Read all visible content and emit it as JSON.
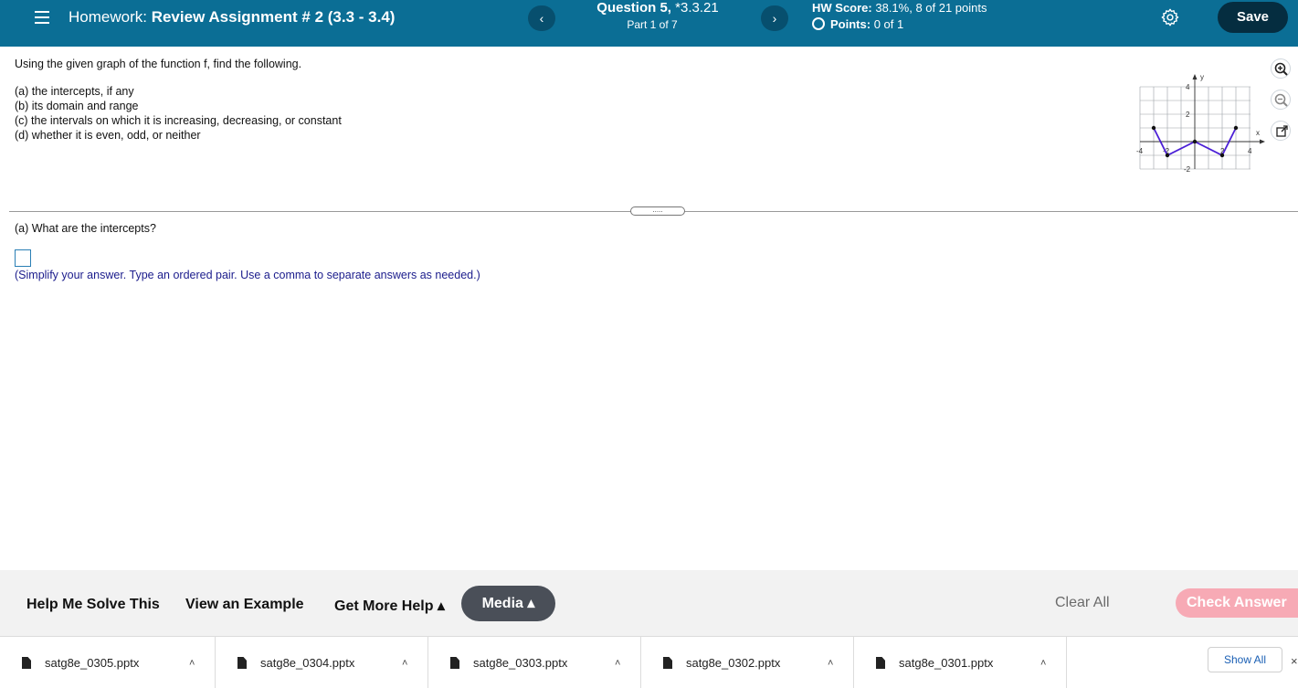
{
  "header": {
    "hw_prefix": "Homework:",
    "hw_name": "Review Assignment # 2 (3.3 - 3.4)",
    "question_label": "Question 5,",
    "question_ref": "*3.3.21",
    "part": "Part 1 of 7",
    "hw_score_label": "HW Score:",
    "hw_score_value": "38.1%, 8 of 21 points",
    "points_label": "Points:",
    "points_value": "0 of 1",
    "prev_label": "‹",
    "next_label": "›",
    "save_label": "Save"
  },
  "question": {
    "prompt": "Using the given graph of the function f, find the following.",
    "parts": [
      "(a)  the intercepts, if any",
      "(b)  its domain and range",
      "(c)  the intervals on which it is increasing, decreasing, or constant",
      "(d)  whether it is even, odd, or neither"
    ],
    "divider_handle": ".....",
    "subquestion": "(a)  What are the intercepts?",
    "hint": "(Simplify your answer. Type an ordered pair. Use a comma to separate answers as needed.)"
  },
  "graph": {
    "x_axis_label": "x",
    "y_axis_label": "y",
    "x_ticks": [
      "-4",
      "-2",
      "2",
      "4"
    ],
    "y_ticks": [
      "4",
      "2",
      "-2"
    ],
    "line_color": "#4b1fd6",
    "points": [
      [
        -3,
        1
      ],
      [
        -2,
        -1
      ],
      [
        0,
        0
      ],
      [
        2,
        -1
      ],
      [
        3,
        1
      ]
    ]
  },
  "help_bar": {
    "help_me_solve": "Help Me Solve This",
    "view_example": "View an Example",
    "get_more_help": "Get More Help ▴",
    "media": "Media ▴",
    "clear_all": "Clear All",
    "check_answer": "Check Answer"
  },
  "downloads": {
    "files": [
      "satg8e_0305.pptx",
      "satg8e_0304.pptx",
      "satg8e_0303.pptx",
      "satg8e_0302.pptx",
      "satg8e_0301.pptx"
    ],
    "show_all": "Show All",
    "close": "×"
  },
  "colors": {
    "topbar": "#0b6e95",
    "save": "#052d40",
    "check_answer": "#f7aab5",
    "hint_text": "#1b1c8c"
  }
}
